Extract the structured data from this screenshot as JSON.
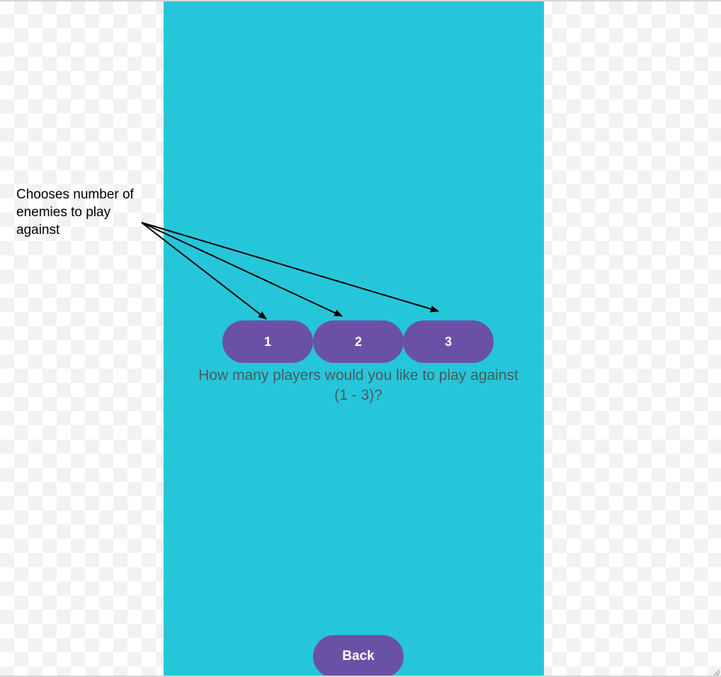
{
  "screen": {
    "background_color": "#26c6da",
    "button_color": "#6a51a6",
    "player_options": [
      "1",
      "2",
      "3"
    ],
    "prompt": "How many players would you like to play against (1 - 3)?",
    "back_label": "Back"
  },
  "annotation": {
    "text": "Chooses number of\nenemies to play\nagainst"
  },
  "icons": {
    "resize_grip": "resize-grip-icon",
    "arrow": "arrow-icon"
  }
}
